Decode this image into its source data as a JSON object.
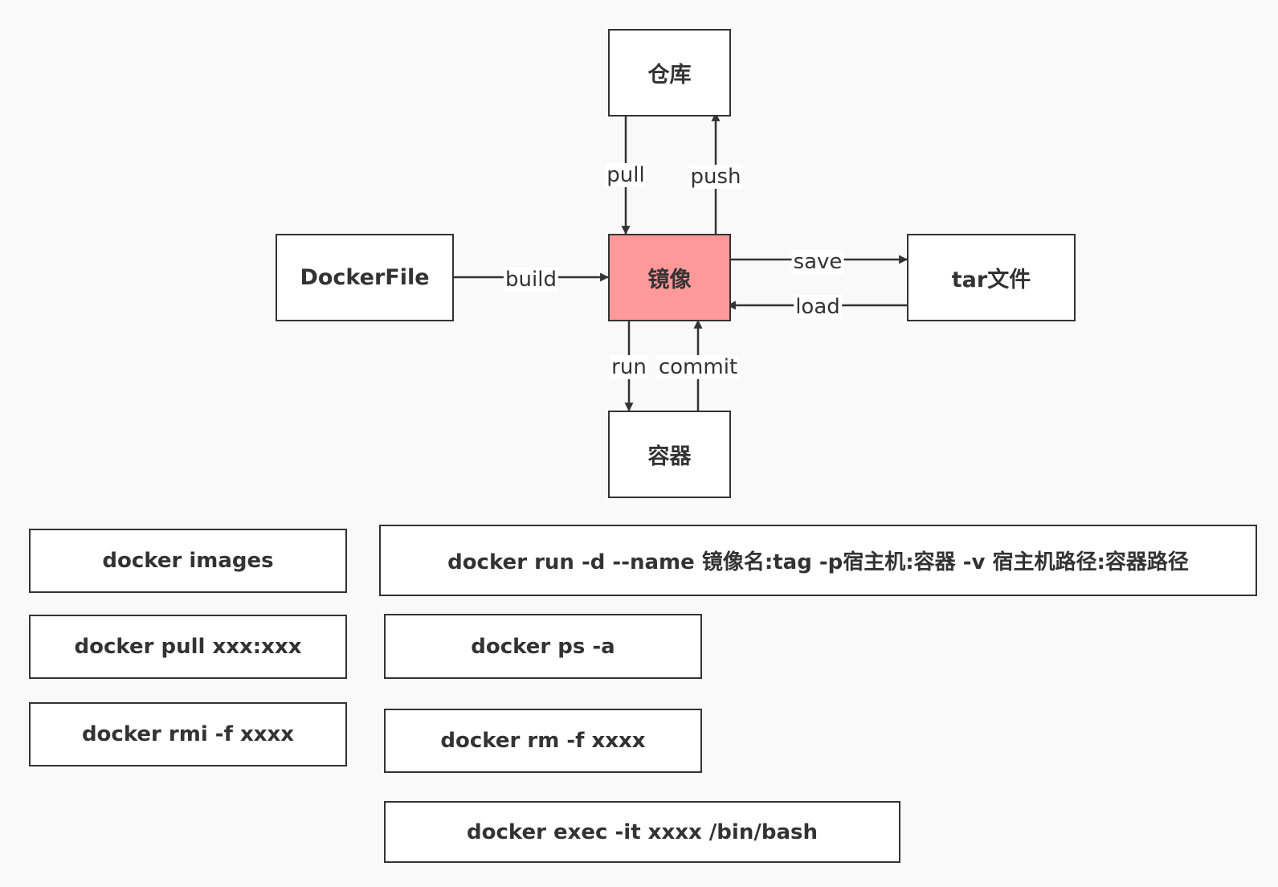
{
  "colors": {
    "background": "#f9f9f9",
    "stroke": "#333333",
    "box_fill": "#ffffff",
    "highlight_fill": "#ff9999"
  },
  "diagram": {
    "nodes": {
      "repository": "仓库",
      "image": "镜像",
      "dockerfile": "DockerFile",
      "tar_file": "tar文件",
      "container": "容器"
    },
    "edges": {
      "pull": "pull",
      "push": "push",
      "build": "build",
      "save": "save",
      "load": "load",
      "run": "run",
      "commit": "commit"
    }
  },
  "commands": {
    "images": "docker images",
    "pull": "docker pull xxx:xxx",
    "rmi": "docker rmi -f  xxxx",
    "run": "docker run -d --name 镜像名:tag -p宿主机:容器 -v  宿主机路径:容器路径",
    "ps": "docker ps -a",
    "rm": "docker rm -f  xxxx",
    "exec": "docker exec -it  xxxx  /bin/bash"
  }
}
